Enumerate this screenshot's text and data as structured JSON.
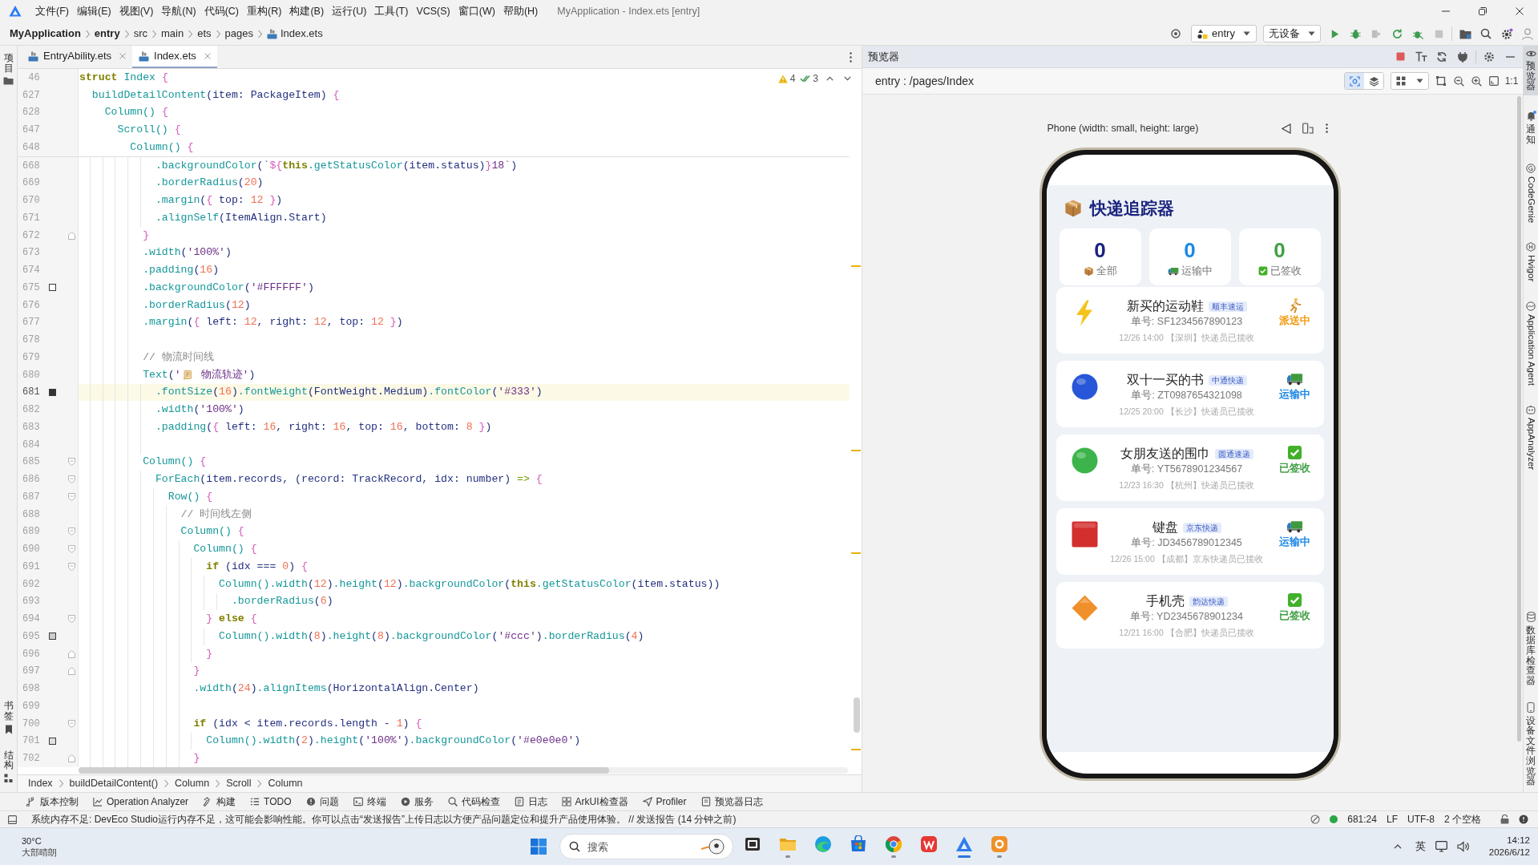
{
  "window": {
    "title": "MyApplication - Index.ets [entry]"
  },
  "menu": [
    "文件(F)",
    "编辑(E)",
    "视图(V)",
    "导航(N)",
    "代码(C)",
    "重构(R)",
    "构建(B)",
    "运行(U)",
    "工具(T)",
    "VCS(S)",
    "窗口(W)",
    "帮助(H)"
  ],
  "nav_path": [
    {
      "label": "MyApplication",
      "kind": "project"
    },
    {
      "label": "entry",
      "kind": "module"
    },
    {
      "label": "src",
      "kind": "folder"
    },
    {
      "label": "main",
      "kind": "folder"
    },
    {
      "label": "ets",
      "kind": "folder"
    },
    {
      "label": "pages",
      "kind": "folder"
    },
    {
      "label": "Index.ets",
      "kind": "file"
    }
  ],
  "run_config": {
    "module": "entry",
    "device": "无设备"
  },
  "run_actions": [
    {
      "kind": "run",
      "disabled": false
    },
    {
      "kind": "debug",
      "disabled": false
    },
    {
      "kind": "attach",
      "disabled": true
    },
    {
      "kind": "reload",
      "disabled": false
    },
    {
      "kind": "profile",
      "disabled": false
    },
    {
      "kind": "stop",
      "disabled": true
    }
  ],
  "left_strip": {
    "top": [
      {
        "label": "项目",
        "kind": "project"
      }
    ],
    "bottom": [
      {
        "label": "书签",
        "kind": "bookmark"
      },
      {
        "label": "结构",
        "kind": "structure"
      }
    ]
  },
  "editor_tabs": [
    {
      "label": "EntryAbility.ets",
      "selected": false
    },
    {
      "label": "Index.ets",
      "selected": true
    }
  ],
  "inspections": {
    "warnings": "4",
    "weak_warnings": "3"
  },
  "code": {
    "sticky": [
      {
        "num": "46",
        "tokens": [
          {
            "kind": "kw",
            "text": "struct "
          },
          {
            "kind": "fn",
            "text": "Index "
          },
          {
            "kind": "br",
            "text": "{"
          }
        ]
      },
      {
        "num": "627",
        "tokens": [
          {
            "kind": "fn",
            "text": "  buildDetailContent"
          },
          {
            "kind": "id",
            "text": "(item: PackageItem) "
          },
          {
            "kind": "br",
            "text": "{"
          }
        ]
      },
      {
        "num": "628",
        "tokens": [
          {
            "kind": "fn",
            "text": "    Column() "
          },
          {
            "kind": "br",
            "text": "{"
          }
        ]
      },
      {
        "num": "647",
        "tokens": [
          {
            "kind": "fn",
            "text": "      Scroll() "
          },
          {
            "kind": "br",
            "text": "{"
          }
        ]
      },
      {
        "num": "648",
        "tokens": [
          {
            "kind": "fn",
            "text": "        Column() "
          },
          {
            "kind": "br",
            "text": "{"
          }
        ]
      }
    ],
    "lines": [
      {
        "num": "668",
        "current": false,
        "tokens": [
          {
            "kind": "fn",
            "text": "            .backgroundColor"
          },
          {
            "kind": "id",
            "text": "("
          },
          {
            "kind": "str",
            "text": "`"
          },
          {
            "kind": "br",
            "text": "${"
          },
          {
            "kind": "kw",
            "text": "this"
          },
          {
            "kind": "fn",
            "text": ".getStatusColor"
          },
          {
            "kind": "id",
            "text": "(item.status)"
          },
          {
            "kind": "br",
            "text": "}"
          },
          {
            "kind": "str",
            "text": "18`"
          },
          {
            "kind": "id",
            "text": ")"
          }
        ]
      },
      {
        "num": "669",
        "current": false,
        "tokens": [
          {
            "kind": "fn",
            "text": "            .borderRadius"
          },
          {
            "kind": "id",
            "text": "("
          },
          {
            "kind": "num",
            "text": "20"
          },
          {
            "kind": "id",
            "text": ")"
          }
        ]
      },
      {
        "num": "670",
        "current": false,
        "tokens": [
          {
            "kind": "fn",
            "text": "            .margin"
          },
          {
            "kind": "id",
            "text": "("
          },
          {
            "kind": "br",
            "text": "{"
          },
          {
            "kind": "id",
            "text": " top: "
          },
          {
            "kind": "num",
            "text": "12"
          },
          {
            "kind": "br",
            "text": " }"
          },
          {
            "kind": "id",
            "text": ")"
          }
        ]
      },
      {
        "num": "671",
        "current": false,
        "tokens": [
          {
            "kind": "fn",
            "text": "            .alignSelf"
          },
          {
            "kind": "id",
            "text": "(ItemAlign.Start)"
          }
        ]
      },
      {
        "num": "672",
        "current": false,
        "fold_marker": {
          "kind": "end"
        },
        "tokens": [
          {
            "kind": "br",
            "text": "          }"
          }
        ]
      },
      {
        "num": "673",
        "current": false,
        "tokens": [
          {
            "kind": "fn",
            "text": "          .width"
          },
          {
            "kind": "id",
            "text": "("
          },
          {
            "kind": "str",
            "text": "'100%'"
          },
          {
            "kind": "id",
            "text": ")"
          }
        ]
      },
      {
        "num": "674",
        "current": false,
        "tokens": [
          {
            "kind": "fn",
            "text": "          .padding"
          },
          {
            "kind": "id",
            "text": "("
          },
          {
            "kind": "num",
            "text": "16"
          },
          {
            "kind": "id",
            "text": ")"
          }
        ]
      },
      {
        "num": "675",
        "current": false,
        "color": "#ffffff",
        "tokens": [
          {
            "kind": "fn",
            "text": "          .backgroundColor"
          },
          {
            "kind": "id",
            "text": "("
          },
          {
            "kind": "str",
            "text": "'#FFFFFF'"
          },
          {
            "kind": "id",
            "text": ")"
          }
        ]
      },
      {
        "num": "676",
        "current": false,
        "tokens": [
          {
            "kind": "fn",
            "text": "          .borderRadius"
          },
          {
            "kind": "id",
            "text": "("
          },
          {
            "kind": "num",
            "text": "12"
          },
          {
            "kind": "id",
            "text": ")"
          }
        ]
      },
      {
        "num": "677",
        "current": false,
        "tokens": [
          {
            "kind": "fn",
            "text": "          .margin"
          },
          {
            "kind": "id",
            "text": "("
          },
          {
            "kind": "br",
            "text": "{"
          },
          {
            "kind": "id",
            "text": " left: "
          },
          {
            "kind": "num",
            "text": "12"
          },
          {
            "kind": "id",
            "text": ", right: "
          },
          {
            "kind": "num",
            "text": "12"
          },
          {
            "kind": "id",
            "text": ", top: "
          },
          {
            "kind": "num",
            "text": "12"
          },
          {
            "kind": "br",
            "text": " }"
          },
          {
            "kind": "id",
            "text": ")"
          }
        ]
      },
      {
        "num": "678",
        "current": false
      },
      {
        "num": "679",
        "current": false,
        "tokens": [
          {
            "kind": "cm",
            "text": "          // 物流时间线"
          }
        ]
      },
      {
        "num": "680",
        "current": false,
        "tokens": [
          {
            "kind": "fn",
            "text": "          Text"
          },
          {
            "kind": "id",
            "text": "("
          },
          {
            "kind": "str",
            "text": "'"
          },
          {
            "kind": "emoji"
          },
          {
            "kind": "str",
            "text": " 物流轨迹'"
          },
          {
            "kind": "id",
            "text": ")"
          }
        ]
      },
      {
        "num": "681",
        "current": true,
        "color": "#333333",
        "tokens": [
          {
            "kind": "fn",
            "text": "            .fontSize"
          },
          {
            "kind": "id",
            "text": "("
          },
          {
            "kind": "num",
            "text": "16"
          },
          {
            "kind": "id",
            "text": ")"
          },
          {
            "kind": "fn",
            "text": ".fontWeight"
          },
          {
            "kind": "id",
            "text": "(FontWeight.Medium)"
          },
          {
            "kind": "fn",
            "text": ".fontColor"
          },
          {
            "kind": "id",
            "text": "("
          },
          {
            "kind": "str",
            "text": "'#333'"
          },
          {
            "kind": "id",
            "text": ")"
          }
        ]
      },
      {
        "num": "682",
        "current": false,
        "tokens": [
          {
            "kind": "fn",
            "text": "            .width"
          },
          {
            "kind": "id",
            "text": "("
          },
          {
            "kind": "str",
            "text": "'100%'"
          },
          {
            "kind": "id",
            "text": ")"
          }
        ]
      },
      {
        "num": "683",
        "current": false,
        "tokens": [
          {
            "kind": "fn",
            "text": "            .padding"
          },
          {
            "kind": "id",
            "text": "("
          },
          {
            "kind": "br",
            "text": "{"
          },
          {
            "kind": "id",
            "text": " left: "
          },
          {
            "kind": "num",
            "text": "16"
          },
          {
            "kind": "id",
            "text": ", right: "
          },
          {
            "kind": "num",
            "text": "16"
          },
          {
            "kind": "id",
            "text": ", top: "
          },
          {
            "kind": "num",
            "text": "16"
          },
          {
            "kind": "id",
            "text": ", bottom: "
          },
          {
            "kind": "num",
            "text": "8"
          },
          {
            "kind": "br",
            "text": " }"
          },
          {
            "kind": "id",
            "text": ")"
          }
        ]
      },
      {
        "num": "684",
        "current": false
      },
      {
        "num": "685",
        "current": false,
        "fold_marker": {
          "kind": "start"
        },
        "tokens": [
          {
            "kind": "fn",
            "text": "          Column() "
          },
          {
            "kind": "br",
            "text": "{"
          }
        ]
      },
      {
        "num": "686",
        "current": false,
        "fold_marker": {
          "kind": "start"
        },
        "tokens": [
          {
            "kind": "fn",
            "text": "            ForEach"
          },
          {
            "kind": "id",
            "text": "(item.records, (record: TrackRecord, idx: number) "
          },
          {
            "kind": "op",
            "text": "=>"
          },
          {
            "kind": "br",
            "text": " {"
          }
        ]
      },
      {
        "num": "687",
        "current": false,
        "fold_marker": {
          "kind": "start"
        },
        "tokens": [
          {
            "kind": "fn",
            "text": "              Row() "
          },
          {
            "kind": "br",
            "text": "{"
          }
        ]
      },
      {
        "num": "688",
        "current": false,
        "tokens": [
          {
            "kind": "cm",
            "text": "                // 时间线左侧"
          }
        ]
      },
      {
        "num": "689",
        "current": false,
        "fold_marker": {
          "kind": "start"
        },
        "tokens": [
          {
            "kind": "fn",
            "text": "                Column() "
          },
          {
            "kind": "br",
            "text": "{"
          }
        ]
      },
      {
        "num": "690",
        "current": false,
        "fold_marker": {
          "kind": "start"
        },
        "tokens": [
          {
            "kind": "fn",
            "text": "                  Column() "
          },
          {
            "kind": "br",
            "text": "{"
          }
        ]
      },
      {
        "num": "691",
        "current": false,
        "fold_marker": {
          "kind": "start"
        },
        "tokens": [
          {
            "kind": "kw",
            "text": "                    if "
          },
          {
            "kind": "id",
            "text": "(idx === "
          },
          {
            "kind": "num",
            "text": "0"
          },
          {
            "kind": "id",
            "text": ") "
          },
          {
            "kind": "br",
            "text": "{"
          }
        ]
      },
      {
        "num": "692",
        "current": false,
        "tokens": [
          {
            "kind": "fn",
            "text": "                      Column().width"
          },
          {
            "kind": "id",
            "text": "("
          },
          {
            "kind": "num",
            "text": "12"
          },
          {
            "kind": "id",
            "text": ")"
          },
          {
            "kind": "fn",
            "text": ".height"
          },
          {
            "kind": "id",
            "text": "("
          },
          {
            "kind": "num",
            "text": "12"
          },
          {
            "kind": "id",
            "text": ")"
          },
          {
            "kind": "fn",
            "text": ".backgroundColor"
          },
          {
            "kind": "id",
            "text": "("
          },
          {
            "kind": "kw",
            "text": "this"
          },
          {
            "kind": "fn",
            "text": ".getStatusColor"
          },
          {
            "kind": "id",
            "text": "(item.status))"
          }
        ]
      },
      {
        "num": "693",
        "current": false,
        "tokens": [
          {
            "kind": "fn",
            "text": "                        .borderRadius"
          },
          {
            "kind": "id",
            "text": "("
          },
          {
            "kind": "num",
            "text": "6"
          },
          {
            "kind": "id",
            "text": ")"
          }
        ]
      },
      {
        "num": "694",
        "current": false,
        "fold_marker": {
          "kind": "start"
        },
        "tokens": [
          {
            "kind": "br",
            "text": "                    } "
          },
          {
            "kind": "kw",
            "text": "else "
          },
          {
            "kind": "br",
            "text": "{"
          }
        ]
      },
      {
        "num": "695",
        "current": false,
        "color": "#cccccc",
        "tokens": [
          {
            "kind": "fn",
            "text": "                      Column().width"
          },
          {
            "kind": "id",
            "text": "("
          },
          {
            "kind": "num",
            "text": "8"
          },
          {
            "kind": "id",
            "text": ")"
          },
          {
            "kind": "fn",
            "text": ".height"
          },
          {
            "kind": "id",
            "text": "("
          },
          {
            "kind": "num",
            "text": "8"
          },
          {
            "kind": "id",
            "text": ")"
          },
          {
            "kind": "fn",
            "text": ".backgroundColor"
          },
          {
            "kind": "id",
            "text": "("
          },
          {
            "kind": "str",
            "text": "'#ccc'"
          },
          {
            "kind": "id",
            "text": ")"
          },
          {
            "kind": "fn",
            "text": ".borderRadius"
          },
          {
            "kind": "id",
            "text": "("
          },
          {
            "kind": "num",
            "text": "4"
          },
          {
            "kind": "id",
            "text": ")"
          }
        ]
      },
      {
        "num": "696",
        "current": false,
        "fold_marker": {
          "kind": "end"
        },
        "tokens": [
          {
            "kind": "br",
            "text": "                    }"
          }
        ]
      },
      {
        "num": "697",
        "current": false,
        "fold_marker": {
          "kind": "end"
        },
        "tokens": [
          {
            "kind": "br",
            "text": "                  }"
          }
        ]
      },
      {
        "num": "698",
        "current": false,
        "tokens": [
          {
            "kind": "fn",
            "text": "                  .width"
          },
          {
            "kind": "id",
            "text": "("
          },
          {
            "kind": "num",
            "text": "24"
          },
          {
            "kind": "id",
            "text": ")"
          },
          {
            "kind": "fn",
            "text": ".alignItems"
          },
          {
            "kind": "id",
            "text": "(HorizontalAlign.Center)"
          }
        ]
      },
      {
        "num": "699",
        "current": false
      },
      {
        "num": "700",
        "current": false,
        "fold_marker": {
          "kind": "start"
        },
        "tokens": [
          {
            "kind": "kw",
            "text": "                  if "
          },
          {
            "kind": "id",
            "text": "(idx < item.records.length - "
          },
          {
            "kind": "num",
            "text": "1"
          },
          {
            "kind": "id",
            "text": ") "
          },
          {
            "kind": "br",
            "text": "{"
          }
        ]
      },
      {
        "num": "701",
        "current": false,
        "color": "#e0e0e0",
        "tokens": [
          {
            "kind": "fn",
            "text": "                    Column().width"
          },
          {
            "kind": "id",
            "text": "("
          },
          {
            "kind": "num",
            "text": "2"
          },
          {
            "kind": "id",
            "text": ")"
          },
          {
            "kind": "fn",
            "text": ".height"
          },
          {
            "kind": "id",
            "text": "("
          },
          {
            "kind": "str",
            "text": "'100%'"
          },
          {
            "kind": "id",
            "text": ")"
          },
          {
            "kind": "fn",
            "text": ".backgroundColor"
          },
          {
            "kind": "id",
            "text": "("
          },
          {
            "kind": "str",
            "text": "'#e0e0e0'"
          },
          {
            "kind": "id",
            "text": ")"
          }
        ]
      },
      {
        "num": "702",
        "current": false,
        "fold_marker": {
          "kind": "end"
        },
        "tokens": [
          {
            "kind": "br",
            "text": "                  }"
          }
        ]
      }
    ]
  },
  "editor_path": [
    "Index",
    "buildDetailContent()",
    "Column",
    "Scroll",
    "Column"
  ],
  "preview": {
    "title": "预览器",
    "route": "entry : /pages/Index",
    "modes": [
      {
        "kind": "inspect",
        "selected": true
      },
      {
        "kind": "layers",
        "selected": false
      }
    ],
    "actual_size": "1:1",
    "device": "Phone (width: small, height: large)",
    "app": {
      "title": "快递追踪器",
      "stats": [
        {
          "value": "0",
          "label": "全部",
          "kind": "all",
          "color": "#1a237e"
        },
        {
          "value": "0",
          "label": "运输中",
          "kind": "transit",
          "color": "#1e88e5"
        },
        {
          "value": "0",
          "label": "已签收",
          "kind": "signed",
          "color": "#43a047"
        }
      ],
      "packages": [
        {
          "name": "新买的运动鞋",
          "courier": "顺丰速运",
          "tracking": "单号: SF1234567890123",
          "latest": "12/26 14:00 【深圳】快递员已揽收",
          "kind": "bolt",
          "color": "#f7c31a",
          "status": {
            "label": "派送中",
            "kind": "delivering",
            "color": "#f39c12"
          }
        },
        {
          "name": "双十一买的书",
          "courier": "中通快递",
          "tracking": "单号: ZT0987654321098",
          "latest": "12/25 20:00 【长沙】快递员已揽收",
          "kind": "sphere",
          "color": "#2756d8",
          "status": {
            "label": "运输中",
            "kind": "transit",
            "color": "#1e88e5"
          }
        },
        {
          "name": "女朋友送的围巾",
          "courier": "圆通速递",
          "tracking": "单号: YT5678901234567",
          "latest": "12/23 16:30 【杭州】快递员已揽收",
          "kind": "sphere",
          "color": "#3cb44b",
          "status": {
            "label": "已签收",
            "kind": "signed",
            "color": "#43a047"
          }
        },
        {
          "name": "键盘",
          "courier": "京东快递",
          "tracking": "单号: JD3456789012345",
          "latest": "12/26 15:00 【成都】京东快递员已揽收",
          "kind": "block",
          "color": "#d32f2f",
          "status": {
            "label": "运输中",
            "kind": "transit",
            "color": "#1e88e5"
          }
        },
        {
          "name": "手机壳",
          "courier": "韵达快递",
          "tracking": "单号: YD2345678901234",
          "latest": "12/21 16:00 【合肥】快递员已揽收",
          "kind": "diamond",
          "color": "#f0902a",
          "status": {
            "label": "已签收",
            "kind": "signed",
            "color": "#43a047"
          }
        }
      ]
    }
  },
  "right_strip": {
    "top": [
      {
        "label": "预览器",
        "kind": "preview",
        "selected": true
      },
      {
        "label": "通知",
        "kind": "notifications",
        "selected": false
      },
      {
        "label": "CodeGenie",
        "kind": "codegenie",
        "selected": false
      },
      {
        "label": "Hvigor",
        "kind": "hvigor",
        "selected": false
      },
      {
        "label": "Application Agent",
        "kind": "agent",
        "selected": false
      },
      {
        "label": "AppAnalyzer",
        "kind": "analyzer",
        "selected": false
      }
    ],
    "bottom": [
      {
        "label": "数据库检查器",
        "kind": "database",
        "selected": false
      },
      {
        "label": "设备文件浏览器",
        "kind": "device",
        "selected": false
      }
    ]
  },
  "tool_windows": [
    {
      "label": "版本控制",
      "kind": "vcs"
    },
    {
      "label": "Operation Analyzer",
      "kind": "analyzer"
    },
    {
      "label": "构建",
      "kind": "build"
    },
    {
      "label": "TODO",
      "kind": "todo"
    },
    {
      "label": "问题",
      "kind": "problems"
    },
    {
      "label": "终端",
      "kind": "terminal"
    },
    {
      "label": "服务",
      "kind": "services"
    },
    {
      "label": "代码检查",
      "kind": "inspect"
    },
    {
      "label": "日志",
      "kind": "log"
    },
    {
      "label": "ArkUI检查器",
      "kind": "arkui"
    },
    {
      "label": "Profiler",
      "kind": "profiler"
    },
    {
      "label": "预览器日志",
      "kind": "previewlog"
    }
  ],
  "status_bar": {
    "message": "系统内存不足: DevEco Studio运行内存不足，这可能会影响性能。你可以点击“发送报告”上传日志以方便产品问题定位和提升产品使用体验。 // 发送报告 (14 分钟之前)",
    "position": "681:24",
    "line_separator": "LF",
    "encoding": "UTF-8",
    "indent": "2 个空格"
  },
  "taskbar": {
    "weather": {
      "temperature": "30°C",
      "condition": "大部晴朗"
    },
    "search": {
      "placeholder": "搜索"
    },
    "apps": [
      {
        "kind": "taskview",
        "running": false,
        "active": false
      },
      {
        "kind": "explorer",
        "running": true,
        "active": false
      },
      {
        "kind": "edge",
        "running": false,
        "active": false
      },
      {
        "kind": "store",
        "running": false,
        "active": false
      },
      {
        "kind": "chrome",
        "running": true,
        "active": false
      },
      {
        "kind": "wps",
        "running": false,
        "active": false
      },
      {
        "kind": "deveco",
        "running": true,
        "active": true
      },
      {
        "kind": "app",
        "running": true,
        "active": false
      }
    ],
    "input_method": "英",
    "clock": {
      "time": "14:12",
      "date": "2026/6/12"
    }
  }
}
